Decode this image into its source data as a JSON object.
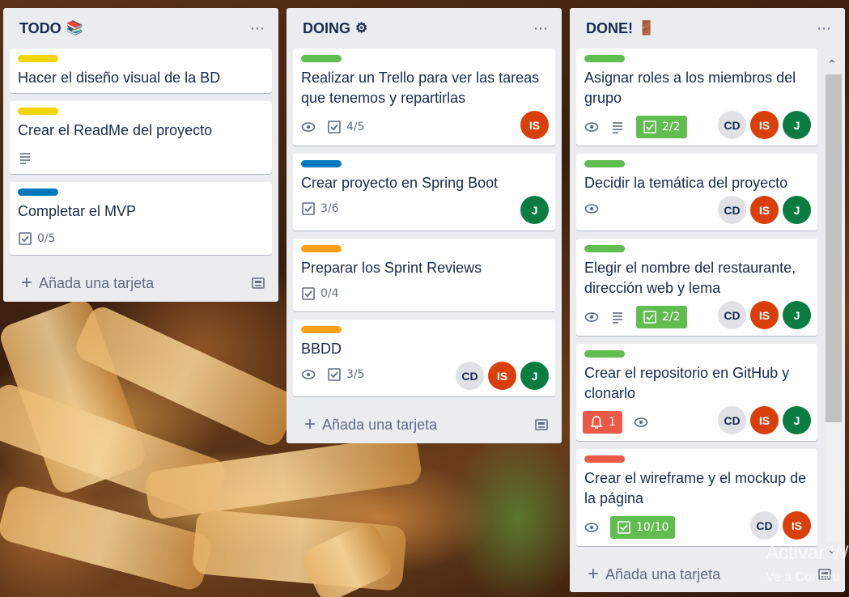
{
  "colors": {
    "label_yellow": "#f2d600",
    "label_green": "#61bd4f",
    "label_blue": "#0079bf",
    "label_orange": "#ff9f1a",
    "label_red": "#eb5a46",
    "avatar_is": "#d93f0b",
    "avatar_j": "#0a7c42",
    "avatar_cd": "#dfe1e6"
  },
  "lists": {
    "todo": {
      "title": "TODO",
      "emoji": "📚",
      "add_label": "Añada una tarjeta",
      "cards": [
        {
          "title": "Hacer el diseño visual de la BD",
          "label": "yellow"
        },
        {
          "title": "Crear el ReadMe del proyecto",
          "label": "yellow",
          "description_icon": "description-icon"
        },
        {
          "title": "Completar el MVP",
          "label": "blue",
          "checklist": "0/5"
        }
      ]
    },
    "doing": {
      "title": "DOING",
      "emoji": "⚙",
      "add_label": "Añada una tarjeta",
      "cards": [
        {
          "title_line1": "Realizar un Trello para ver las tareas",
          "title_line2": "que tenemos y repartirlas",
          "label": "green",
          "checklist": "4/5",
          "members": [
            "IS"
          ]
        },
        {
          "title": "Crear proyecto en Spring Boot",
          "label": "blue",
          "checklist": "3/6",
          "members": [
            "J"
          ]
        },
        {
          "title": "Preparar los Sprint Reviews",
          "label": "orange",
          "checklist": "0/4"
        },
        {
          "title": "BBDD",
          "label": "orange",
          "checklist": "3/5",
          "members": [
            "CD",
            "IS",
            "J"
          ]
        }
      ]
    },
    "done": {
      "title": "DONE!",
      "emoji": "🚪",
      "add_label": "Añada una tarjeta",
      "cards": [
        {
          "title_line1": "Asignar roles a los miembros del",
          "title_line2": "grupo",
          "label": "green",
          "checklist": "2/2",
          "members": [
            "CD",
            "IS",
            "J"
          ]
        },
        {
          "title": "Decidir la temática del proyecto",
          "label": "green",
          "members": [
            "CD",
            "IS",
            "J"
          ]
        },
        {
          "title_line1": "Elegir el nombre del restaurante,",
          "title_line2": "dirección web y lema",
          "label": "green",
          "checklist": "2/2",
          "members": [
            "CD",
            "IS",
            "J"
          ]
        },
        {
          "title_line1": "Crear el repositorio en GitHub y",
          "title_line2": "clonarlo",
          "label": "green",
          "notifications": "1",
          "members": [
            "CD",
            "IS",
            "J"
          ]
        },
        {
          "title_line1": "Crear el wireframe y el mockup de",
          "title_line2": "la página",
          "label": "red",
          "checklist": "10/10",
          "members": [
            "CD",
            "IS"
          ]
        }
      ]
    }
  },
  "more_icon": "⋯",
  "watermark": {
    "line1": "Activar W",
    "line2": "Ve a Configu"
  }
}
